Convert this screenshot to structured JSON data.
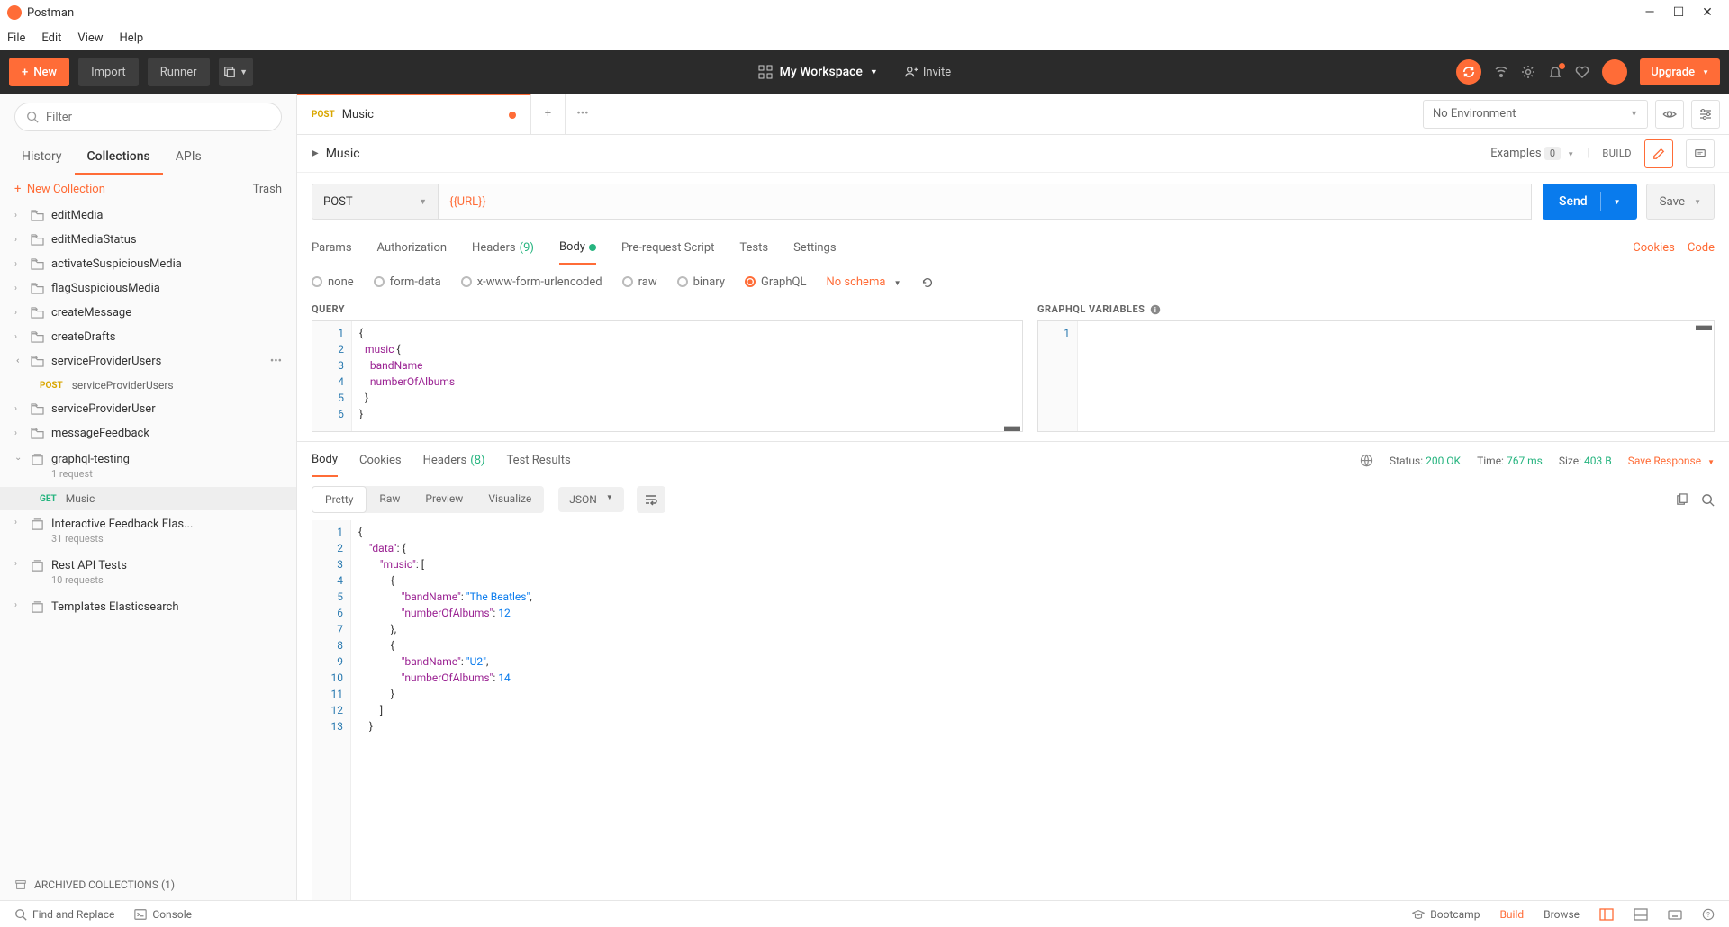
{
  "app": {
    "title": "Postman"
  },
  "menubar": [
    "File",
    "Edit",
    "View",
    "Help"
  ],
  "topbar": {
    "new_label": "New",
    "import_label": "Import",
    "runner_label": "Runner",
    "workspace": "My Workspace",
    "invite": "Invite",
    "upgrade": "Upgrade"
  },
  "sidebar": {
    "filter_placeholder": "Filter",
    "tabs": {
      "history": "History",
      "collections": "Collections",
      "apis": "APIs"
    },
    "new_collection": "New Collection",
    "trash": "Trash",
    "folders": [
      {
        "name": "editMedia"
      },
      {
        "name": "editMediaStatus"
      },
      {
        "name": "activateSuspiciousMedia"
      },
      {
        "name": "flagSuspiciousMedia"
      },
      {
        "name": "createMessage"
      },
      {
        "name": "createDrafts"
      },
      {
        "name": "serviceProviderUsers",
        "expanded": true,
        "requests": [
          {
            "method": "POST",
            "name": "serviceProviderUsers"
          }
        ]
      },
      {
        "name": "serviceProviderUser"
      },
      {
        "name": "messageFeedback"
      }
    ],
    "collections": [
      {
        "name": "graphql-testing",
        "sub": "1 request",
        "expanded": true,
        "requests": [
          {
            "method": "GET",
            "name": "Music",
            "active": true
          }
        ]
      },
      {
        "name": "Interactive Feedback Elas...",
        "sub": "31 requests"
      },
      {
        "name": "Rest API Tests",
        "sub": "10 requests"
      },
      {
        "name": "Templates Elasticsearch"
      }
    ],
    "archived": "ARCHIVED COLLECTIONS (1)"
  },
  "environment": {
    "selected": "No Environment"
  },
  "request_tab": {
    "method": "POST",
    "name": "Music",
    "dirty": true
  },
  "request": {
    "name": "Music",
    "examples_label": "Examples",
    "examples_count": "0",
    "build_label": "BUILD",
    "method": "POST",
    "url": "{{URL}}",
    "send": "Send",
    "save": "Save",
    "subtabs": {
      "params": "Params",
      "authorization": "Authorization",
      "headers": "Headers",
      "headers_count": "(9)",
      "body": "Body",
      "prerequest": "Pre-request Script",
      "tests": "Tests",
      "settings": "Settings",
      "cookies": "Cookies",
      "code": "Code"
    },
    "body_types": {
      "none": "none",
      "formdata": "form-data",
      "urlencoded": "x-www-form-urlencoded",
      "raw": "raw",
      "binary": "binary",
      "graphql": "GraphQL",
      "no_schema": "No schema"
    },
    "gql": {
      "query_label": "QUERY",
      "vars_label": "GRAPHQL VARIABLES",
      "query_lines": [
        "{",
        "  music {",
        "    bandName",
        "    numberOfAlbums",
        "  }",
        "}"
      ]
    }
  },
  "response": {
    "tabs": {
      "body": "Body",
      "cookies": "Cookies",
      "headers": "Headers",
      "headers_count": "(8)",
      "tests": "Test Results"
    },
    "status_label": "Status:",
    "status": "200 OK",
    "time_label": "Time:",
    "time": "767 ms",
    "size_label": "Size:",
    "size": "403 B",
    "save_response": "Save Response",
    "view": {
      "pretty": "Pretty",
      "raw": "Raw",
      "preview": "Preview",
      "visualize": "Visualize",
      "format": "JSON"
    },
    "json_lines": [
      "{",
      "    \"data\": {",
      "        \"music\": [",
      "            {",
      "                \"bandName\": \"The Beatles\",",
      "                \"numberOfAlbums\": 12",
      "            },",
      "            {",
      "                \"bandName\": \"U2\",",
      "                \"numberOfAlbums\": 14",
      "            }",
      "        ]",
      "    }"
    ]
  },
  "statusbar": {
    "find": "Find and Replace",
    "console": "Console",
    "bootcamp": "Bootcamp",
    "build": "Build",
    "browse": "Browse"
  }
}
